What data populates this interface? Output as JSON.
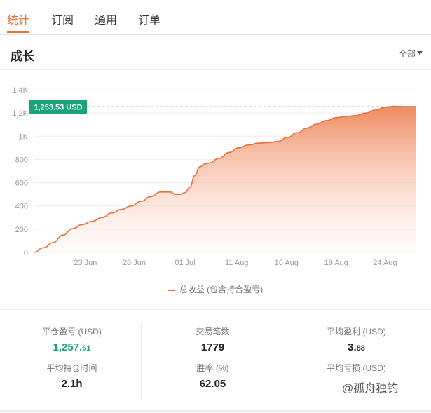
{
  "tabs": [
    {
      "label": "统计",
      "active": true
    },
    {
      "label": "订阅",
      "active": false
    },
    {
      "label": "通用",
      "active": false
    },
    {
      "label": "订单",
      "active": false
    }
  ],
  "header": {
    "title": "成长",
    "filter_label": "全部"
  },
  "chart_data": {
    "type": "area",
    "title": "",
    "xlabel": "",
    "ylabel": "",
    "ylim": [
      0,
      1400
    ],
    "yticks": [
      "0",
      "200",
      "400",
      "600",
      "800",
      "1K",
      "1.2K",
      "1.4K"
    ],
    "ytick_values": [
      0,
      200,
      400,
      600,
      800,
      1000,
      1200,
      1400
    ],
    "xticks": [
      "23 Jun",
      "28 Jun",
      "01 Jul",
      "11 Aug",
      "16 Aug",
      "19 Aug",
      "24 Aug"
    ],
    "xtick_positions": [
      5.3,
      10.3,
      15.5,
      20.8,
      25.9,
      31.0,
      36.0
    ],
    "series": [
      {
        "name": "总收益 (包含持合盈亏)",
        "x": [
          0,
          1,
          2,
          3,
          4,
          5,
          6,
          7,
          8,
          9,
          10,
          11,
          12,
          13,
          14,
          14.5,
          15,
          15.5,
          16,
          16.5,
          17,
          17.5,
          18,
          19,
          20,
          21,
          22,
          23,
          24,
          25,
          26,
          27,
          28,
          29,
          30,
          31,
          32,
          33,
          34,
          35,
          36,
          37,
          38,
          39.2
        ],
        "values": [
          0,
          40,
          85,
          150,
          205,
          240,
          268,
          300,
          340,
          370,
          400,
          440,
          480,
          520,
          520,
          500,
          500,
          515,
          560,
          660,
          735,
          760,
          770,
          810,
          860,
          900,
          925,
          940,
          945,
          955,
          990,
          1030,
          1070,
          1105,
          1135,
          1160,
          1170,
          1178,
          1200,
          1225,
          1250,
          1258,
          1255,
          1255
        ]
      }
    ],
    "marker": {
      "label": "1,253.53 USD",
      "value": 1253.53
    },
    "legend": "bottom-center",
    "grid": true,
    "line_color": "#e8703c",
    "marker_color": "#1aa37b"
  },
  "stats": [
    {
      "label": "平仓盈亏 (USD)",
      "main": "1,257.",
      "minor": "61",
      "color": "green"
    },
    {
      "label": "交易笔数",
      "main": "1779",
      "minor": "",
      "color": "default"
    },
    {
      "label": "平均盈利 (USD)",
      "main": "3.",
      "minor": "88",
      "color": "default"
    },
    {
      "label": "平均持仓时间",
      "main": "2.1h",
      "minor": "",
      "color": "default"
    },
    {
      "label": "胜率 (%)",
      "main": "62.05",
      "minor": "",
      "color": "default"
    },
    {
      "label": "平均亏损 (USD)",
      "main": "",
      "minor": "",
      "color": "default"
    }
  ],
  "watermark": "@孤舟独钓"
}
